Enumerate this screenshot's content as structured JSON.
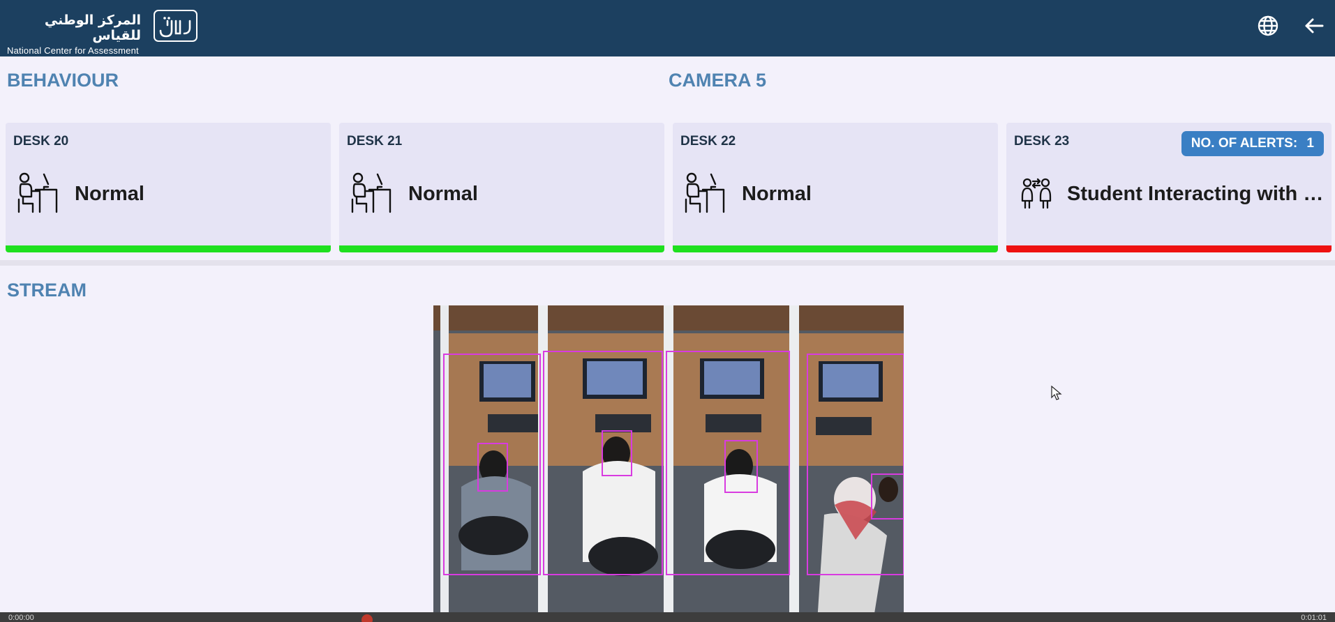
{
  "header": {
    "org_name_ar": "المركز الوطني للقياس",
    "org_name_en": "National Center for Assessment",
    "language_icon": "globe-icon",
    "back_icon": "arrow-left-icon"
  },
  "behaviour": {
    "title": "BEHAVIOUR",
    "camera_title": "CAMERA 5",
    "desks": [
      {
        "label": "DESK 20",
        "status": "Normal",
        "icon": "student-at-desk-icon",
        "status_color": "#1fe01f"
      },
      {
        "label": "DESK 21",
        "status": "Normal",
        "icon": "student-at-desk-icon",
        "status_color": "#1fe01f"
      },
      {
        "label": "DESK 22",
        "status": "Normal",
        "icon": "student-at-desk-icon",
        "status_color": "#1fe01f"
      },
      {
        "label": "DESK 23",
        "status": "Student Interacting with I...",
        "icon": "students-interacting-icon",
        "status_color": "#ee1111",
        "alerts_label": "NO. OF ALERTS:",
        "alerts_count": "1"
      }
    ]
  },
  "stream": {
    "title": "STREAM",
    "time_elapsed": "0:00:00",
    "time_total": "0:01:01"
  },
  "colors": {
    "header_bg": "#1c4060",
    "accent": "#4f83b1",
    "normal": "#1fe01f",
    "alert": "#ee1111",
    "badge": "#3a7fc4"
  }
}
